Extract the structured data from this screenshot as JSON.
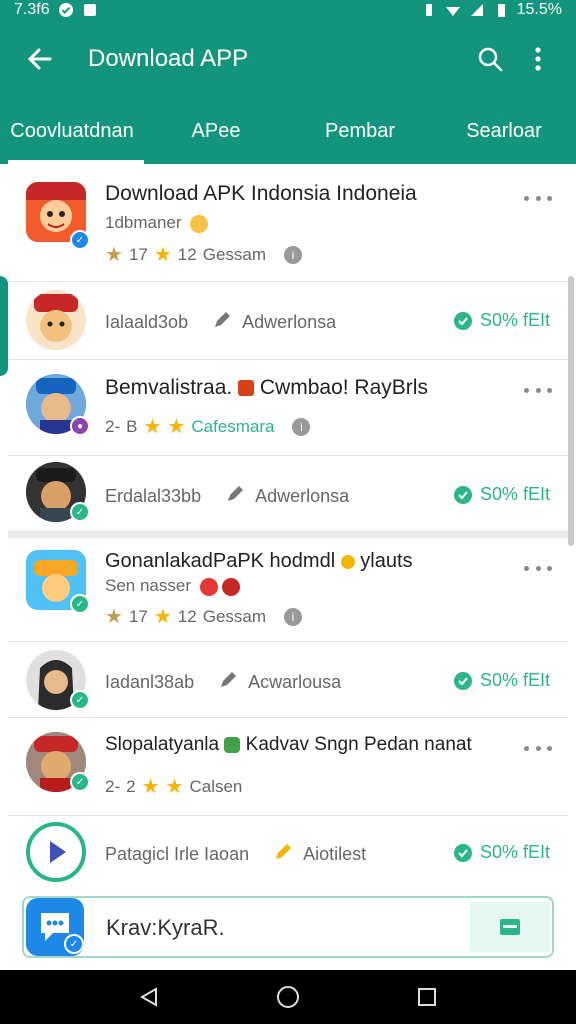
{
  "statusbar": {
    "time": "7.3f6",
    "battery": "15.5%"
  },
  "appbar": {
    "title": "Download APP"
  },
  "tabs": [
    {
      "label": "Coovluatdnan",
      "active": true
    },
    {
      "label": "APee",
      "active": false
    },
    {
      "label": "Pembar",
      "active": false
    },
    {
      "label": "Searloar",
      "active": false
    }
  ],
  "items": [
    {
      "title": "Download APK Indonsia Indoneia",
      "subtitle": "1dbmaner",
      "rating": "17",
      "reviews": "12",
      "meta_label": "Gessam"
    },
    {
      "secondary": "Ialaald3ob",
      "action_label": "Adwerlonsa",
      "status": "S0% fEIt"
    },
    {
      "title": "Bemvalistraa.",
      "title_b": "Cwmbao! RayBrls",
      "count": "2-",
      "count_b": "B",
      "meta_label": "Cafesmara"
    },
    {
      "secondary": "Erdalal33bb",
      "action_label": "Adwerlonsa",
      "status": "S0% fEIt"
    },
    {
      "title": "GonanlakadPaPK hodmdl",
      "title_b": "ylauts",
      "subtitle": "Sen nasser",
      "rating": "17",
      "reviews": "12",
      "meta_label": "Gessam"
    },
    {
      "secondary": "Iadanl38ab",
      "action_label": "Acwarlousa",
      "status": "S0% fEIt"
    },
    {
      "title": "Slopalatyanla",
      "title_b": "Kadvav Sngn Pedan nanat",
      "count": "2-",
      "count_b": "2",
      "meta_label": "Calsen"
    },
    {
      "secondary": "Patagicl Irle Iaoan",
      "action_label": "Aiotilest",
      "status": "S0% fEIt"
    }
  ],
  "bottom": {
    "label": "Krav:KyraR."
  },
  "colors": {
    "primary": "#13957d",
    "accent": "#2bb58b",
    "star": "#f4b400"
  }
}
